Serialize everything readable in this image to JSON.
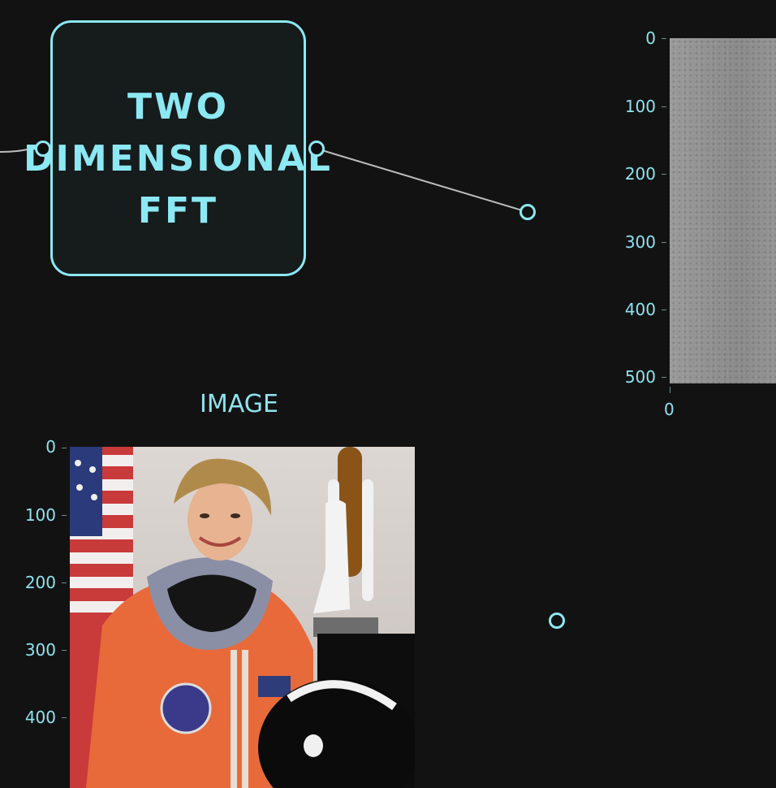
{
  "fft_node": {
    "title_lines": [
      "TWO",
      "DIMENSIONAL",
      "FFT"
    ]
  },
  "fft_plot": {
    "y_ticks": [
      "0",
      "100",
      "200",
      "300",
      "400",
      "500"
    ],
    "x_ticks": [
      "0"
    ]
  },
  "image_plot": {
    "title": "IMAGE",
    "y_ticks": [
      "0",
      "100",
      "200",
      "300",
      "400"
    ]
  },
  "colors": {
    "accent": "#8ce8f2",
    "background": "#121212",
    "node_fill": "#161b1c",
    "wire": "#bbbbbb"
  }
}
